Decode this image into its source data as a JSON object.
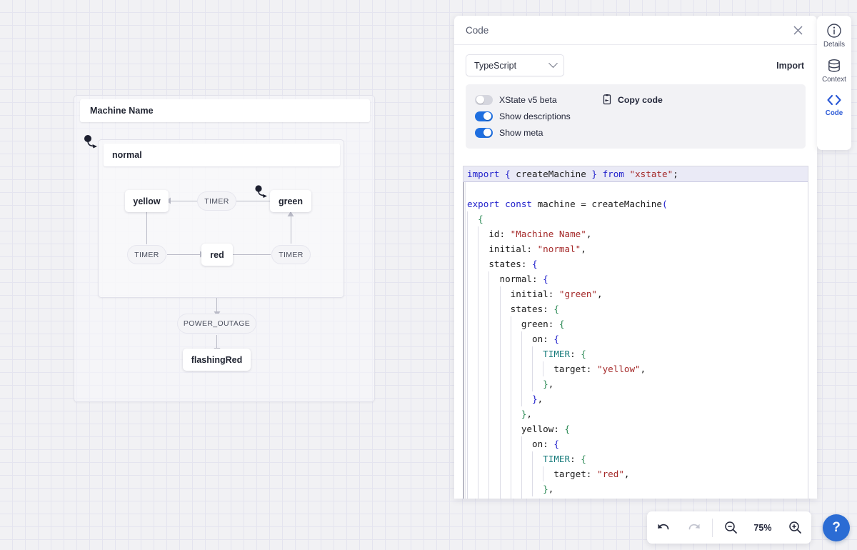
{
  "machine": {
    "title": "Machine Name",
    "compound": {
      "label": "normal"
    },
    "states": [
      {
        "id": "yellow",
        "label": "yellow"
      },
      {
        "id": "green",
        "label": "green"
      },
      {
        "id": "red",
        "label": "red"
      },
      {
        "id": "flashingRed",
        "label": "flashingRed"
      }
    ],
    "events": [
      {
        "id": "timer-green-yellow",
        "label": "TIMER"
      },
      {
        "id": "timer-yellow-red",
        "label": "TIMER"
      },
      {
        "id": "timer-red-green",
        "label": "TIMER"
      },
      {
        "id": "power-outage",
        "label": "POWER_OUTAGE"
      }
    ]
  },
  "code_panel": {
    "title": "Code",
    "close_icon": "close-icon",
    "language": "TypeScript",
    "import_label": "Import",
    "options": [
      {
        "id": "xstate-v5-beta",
        "label": "XState v5 beta",
        "on": false
      },
      {
        "id": "show-descriptions",
        "label": "Show descriptions",
        "on": true
      },
      {
        "id": "show-meta",
        "label": "Show meta",
        "on": true
      }
    ],
    "copy": {
      "label": "Copy code",
      "icon": "copy-icon"
    },
    "editor_lines": [
      [
        {
          "t": "kw",
          "s": "import"
        },
        {
          "t": "pl",
          "s": " "
        },
        {
          "t": "b2",
          "s": "{"
        },
        {
          "t": "pl",
          "s": " createMachine "
        },
        {
          "t": "b2",
          "s": "}"
        },
        {
          "t": "kw",
          "s": " from "
        },
        {
          "t": "str",
          "s": "\"xstate\""
        },
        {
          "t": "pl",
          "s": ";"
        }
      ],
      [],
      [
        {
          "t": "kw",
          "s": "export const"
        },
        {
          "t": "pl",
          "s": " machine = createMachine"
        },
        {
          "t": "b2",
          "s": "("
        }
      ],
      [
        {
          "t": "pl",
          "s": "  "
        },
        {
          "t": "b1",
          "s": "{"
        }
      ],
      [
        {
          "t": "pl",
          "s": "    id: "
        },
        {
          "t": "str",
          "s": "\"Machine Name\""
        },
        {
          "t": "pl",
          "s": ","
        }
      ],
      [
        {
          "t": "pl",
          "s": "    initial: "
        },
        {
          "t": "str",
          "s": "\"normal\""
        },
        {
          "t": "pl",
          "s": ","
        }
      ],
      [
        {
          "t": "pl",
          "s": "    states: "
        },
        {
          "t": "b2",
          "s": "{"
        }
      ],
      [
        {
          "t": "pl",
          "s": "      normal: "
        },
        {
          "t": "b2",
          "s": "{"
        }
      ],
      [
        {
          "t": "pl",
          "s": "        initial: "
        },
        {
          "t": "str",
          "s": "\"green\""
        },
        {
          "t": "pl",
          "s": ","
        }
      ],
      [
        {
          "t": "pl",
          "s": "        states: "
        },
        {
          "t": "b1",
          "s": "{"
        }
      ],
      [
        {
          "t": "pl",
          "s": "          green: "
        },
        {
          "t": "b1",
          "s": "{"
        }
      ],
      [
        {
          "t": "pl",
          "s": "            on: "
        },
        {
          "t": "b2",
          "s": "{"
        }
      ],
      [
        {
          "t": "pl",
          "s": "              "
        },
        {
          "t": "evt",
          "s": "TIMER"
        },
        {
          "t": "pl",
          "s": ": "
        },
        {
          "t": "b1",
          "s": "{"
        }
      ],
      [
        {
          "t": "pl",
          "s": "                target: "
        },
        {
          "t": "str",
          "s": "\"yellow\""
        },
        {
          "t": "pl",
          "s": ","
        }
      ],
      [
        {
          "t": "pl",
          "s": "              "
        },
        {
          "t": "b1",
          "s": "}"
        },
        {
          "t": "pl",
          "s": ","
        }
      ],
      [
        {
          "t": "pl",
          "s": "            "
        },
        {
          "t": "b2",
          "s": "}"
        },
        {
          "t": "pl",
          "s": ","
        }
      ],
      [
        {
          "t": "pl",
          "s": "          "
        },
        {
          "t": "b1",
          "s": "}"
        },
        {
          "t": "pl",
          "s": ","
        }
      ],
      [
        {
          "t": "pl",
          "s": "          yellow: "
        },
        {
          "t": "b1",
          "s": "{"
        }
      ],
      [
        {
          "t": "pl",
          "s": "            on: "
        },
        {
          "t": "b2",
          "s": "{"
        }
      ],
      [
        {
          "t": "pl",
          "s": "              "
        },
        {
          "t": "evt",
          "s": "TIMER"
        },
        {
          "t": "pl",
          "s": ": "
        },
        {
          "t": "b1",
          "s": "{"
        }
      ],
      [
        {
          "t": "pl",
          "s": "                target: "
        },
        {
          "t": "str",
          "s": "\"red\""
        },
        {
          "t": "pl",
          "s": ","
        }
      ],
      [
        {
          "t": "pl",
          "s": "              "
        },
        {
          "t": "b1",
          "s": "}"
        },
        {
          "t": "pl",
          "s": ","
        }
      ],
      [
        {
          "t": "pl",
          "s": "            "
        },
        {
          "t": "b2",
          "s": "}"
        },
        {
          "t": "pl",
          "s": ","
        }
      ]
    ]
  },
  "rail": {
    "items": [
      {
        "id": "details",
        "label": "Details",
        "icon": "info-icon",
        "active": false
      },
      {
        "id": "context",
        "label": "Context",
        "icon": "database-icon",
        "active": false
      },
      {
        "id": "code",
        "label": "Code",
        "icon": "code-brackets-icon",
        "active": true
      }
    ]
  },
  "bottom_toolbar": {
    "undo_icon": "undo-icon",
    "redo_icon": "redo-icon",
    "zoom_out_icon": "zoom-out-icon",
    "zoom_in_icon": "zoom-in-icon",
    "zoom_level": "75%",
    "help_label": "?"
  },
  "colors": {
    "accent": "#2b6cd4",
    "toggle_on": "#1f6fe0",
    "edge": "#b9bac6"
  }
}
